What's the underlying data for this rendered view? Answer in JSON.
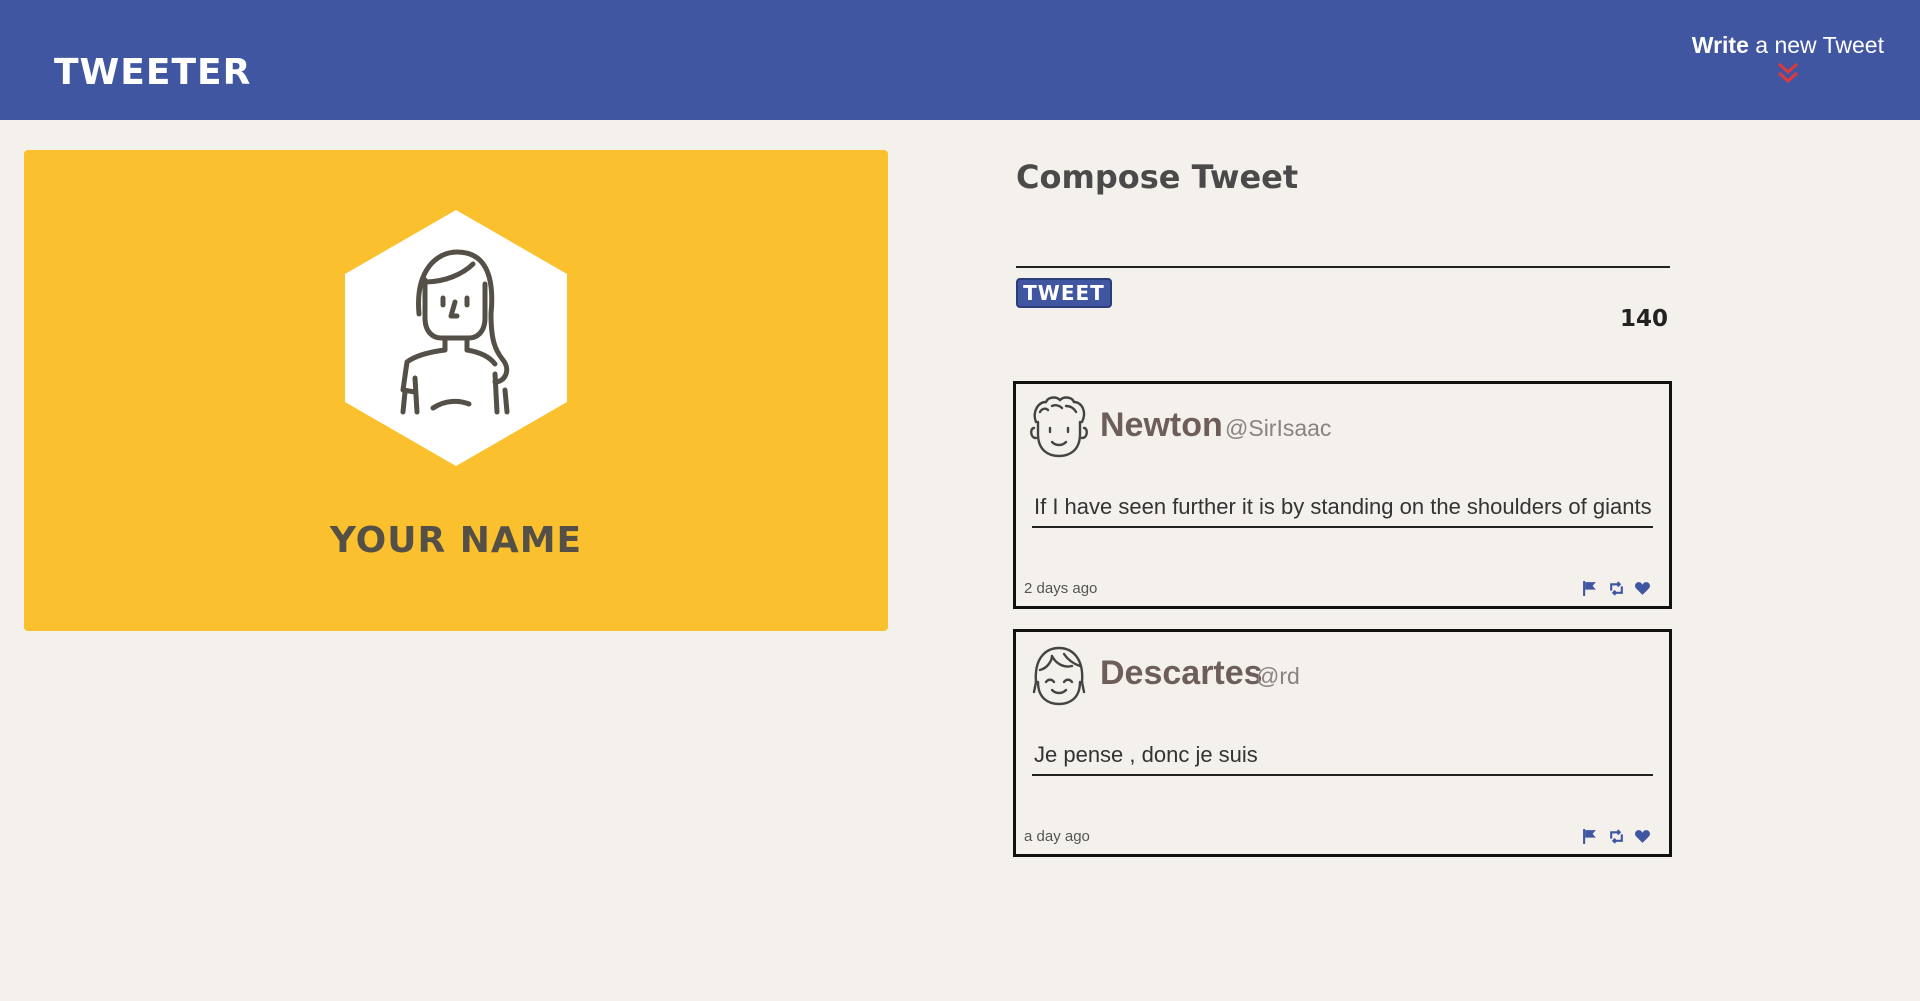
{
  "header": {
    "brand": "TWEETER",
    "write_bold": "Write",
    "write_rest": " a new Tweet",
    "chevron_color": "#e0383b"
  },
  "profile": {
    "name": "YOUR NAME",
    "card_color": "#fbc02d"
  },
  "compose": {
    "title": "Compose Tweet",
    "input_value": "",
    "button_label": "TWEET",
    "counter": "140"
  },
  "tweets": [
    {
      "name": "Newton",
      "handle": "@SirIsaac",
      "text": "If I have seen further it is by standing on the shoulders of giants",
      "time": "2 days ago",
      "avatar_icon": "curly-hair-man-icon"
    },
    {
      "name": "Descartes",
      "handle": "@rd",
      "text": "Je pense , donc je suis",
      "time": "a day ago",
      "avatar_icon": "bangs-girl-icon"
    }
  ],
  "icons": {
    "action_color": "#4056a1",
    "actions": [
      "flag-icon",
      "retweet-icon",
      "heart-icon"
    ]
  },
  "colors": {
    "header": "#4056a1",
    "background": "#f4f1ec"
  }
}
